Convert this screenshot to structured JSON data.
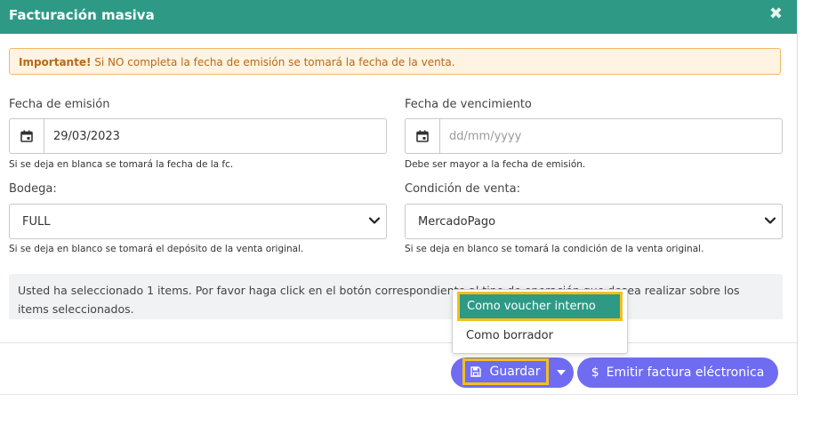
{
  "modal": {
    "title": "Facturación masiva",
    "close_glyph": "✖"
  },
  "alert": {
    "strong": "Importante!",
    "text": " Si NO completa la fecha de emisión se tomará la fecha de la venta."
  },
  "fields": {
    "fecha_emision": {
      "label": "Fecha de emisión",
      "value": "29/03/2023",
      "help": "Si se deja en blanca se tomará la fecha de la fc."
    },
    "fecha_vencimiento": {
      "label": "Fecha de vencimiento",
      "placeholder": "dd/mm/yyyy",
      "help": "Debe ser mayor a la fecha de emisión."
    },
    "bodega": {
      "label": "Bodega:",
      "value": "FULL",
      "help": "Si se deja en blanco se tomará el depósito de la venta original."
    },
    "condicion": {
      "label": "Condición de venta:",
      "value": "MercadoPago",
      "help": "Si se deja en blanco se tomará la condición de la venta original."
    }
  },
  "info": {
    "text": "Usted ha seleccionado 1 items. Por favor haga click en el botón correspondiente al tipo de operación que desea realizar sobre los items seleccionados."
  },
  "dropdown": {
    "items": [
      {
        "label": "Como voucher interno"
      },
      {
        "label": "Como borrador"
      }
    ]
  },
  "buttons": {
    "save_label": "Guardar",
    "emit_label": "Emitir factura eléctronica",
    "emit_glyph": "$"
  },
  "colors": {
    "header": "#2e9a86",
    "accent": "#6f6cf2",
    "highlight": "#f4c01b",
    "alert_bg": "#fff3e2",
    "alert_border": "#f0b76b"
  }
}
